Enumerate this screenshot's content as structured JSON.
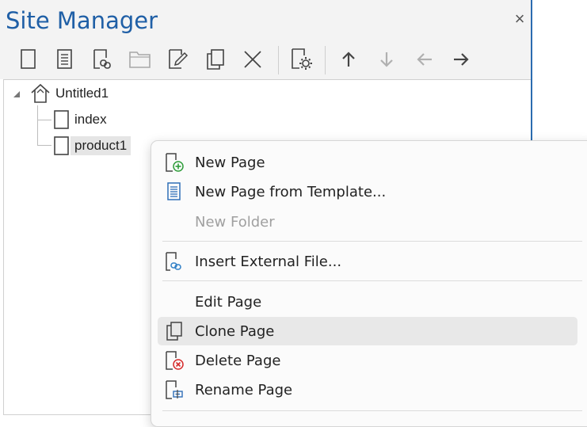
{
  "panel": {
    "title": "Site Manager",
    "close": "×"
  },
  "toolbar": {
    "buttons": [
      {
        "icon": "new-page-icon",
        "enabled": true
      },
      {
        "icon": "template-icon",
        "enabled": true
      },
      {
        "icon": "external-file-icon",
        "enabled": true
      },
      {
        "icon": "folder-icon",
        "enabled": false
      },
      {
        "icon": "edit-icon",
        "enabled": true
      },
      {
        "icon": "clone-icon",
        "enabled": true
      },
      {
        "icon": "delete-icon",
        "enabled": true
      },
      {
        "icon": "page-properties-icon",
        "enabled": true
      },
      {
        "icon": "arrow-up-icon",
        "enabled": true
      },
      {
        "icon": "arrow-down-icon",
        "enabled": false
      },
      {
        "icon": "arrow-left-icon",
        "enabled": false
      },
      {
        "icon": "arrow-right-icon",
        "enabled": true
      }
    ]
  },
  "tree": {
    "root": "Untitled1",
    "children": [
      "index",
      "product1"
    ],
    "selected": "product1"
  },
  "menu": {
    "items": [
      {
        "label": "New Page",
        "icon": "new-page-plus-icon",
        "enabled": true
      },
      {
        "label": "New Page from Template...",
        "icon": "template-icon",
        "enabled": true
      },
      {
        "label": "New Folder",
        "icon": "",
        "enabled": false
      },
      {
        "label": "Insert External File...",
        "icon": "external-file-icon",
        "enabled": true
      },
      {
        "label": "Edit Page",
        "icon": "",
        "enabled": true
      },
      {
        "label": "Clone Page",
        "icon": "clone-icon",
        "enabled": true,
        "highlighted": true
      },
      {
        "label": "Delete Page",
        "icon": "delete-page-icon",
        "enabled": true
      },
      {
        "label": "Rename Page",
        "icon": "rename-page-icon",
        "enabled": true
      }
    ]
  },
  "colors": {
    "title": "#1f5fa6",
    "border": "#2b6cb0",
    "add_green": "#2e9d3a",
    "delete_red": "#d62b2b",
    "link_blue": "#2f7fc6",
    "disabled": "#a0a0a0"
  }
}
